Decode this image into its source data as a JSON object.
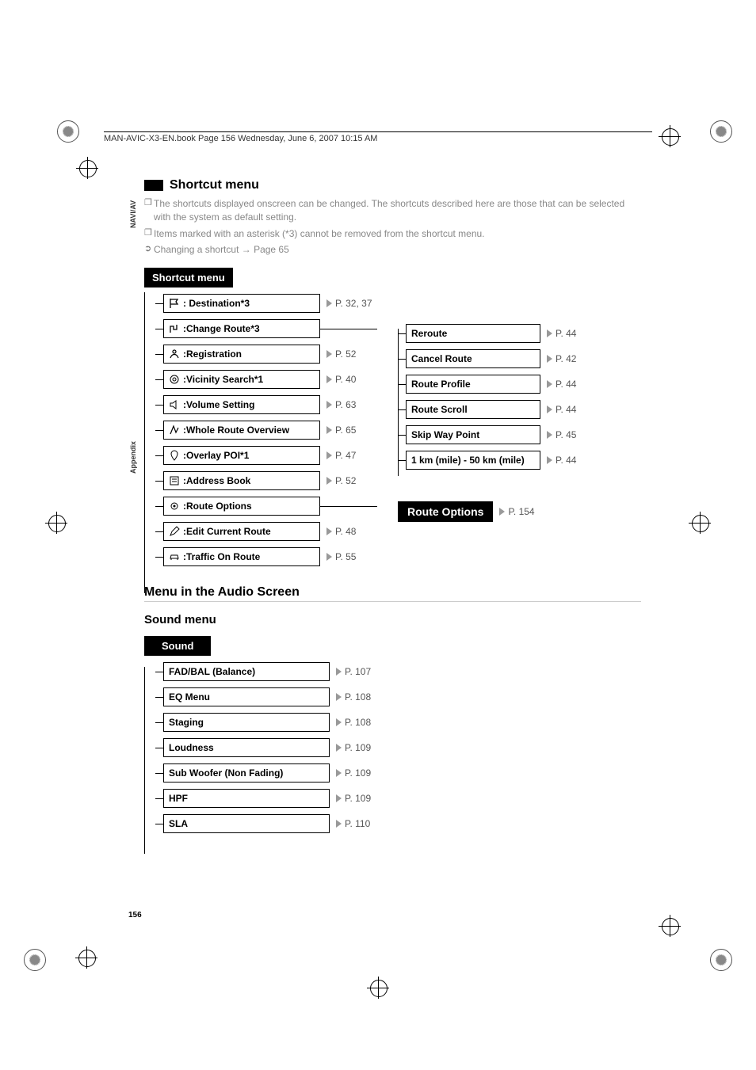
{
  "header_line": "MAN-AVIC-X3-EN.book  Page 156  Wednesday, June 6, 2007  10:15 AM",
  "side_labels": {
    "navav": "NAVI/AV",
    "appendix": "Appendix"
  },
  "shortcut": {
    "title": "Shortcut menu",
    "notes": [
      "The shortcuts displayed onscreen can be changed. The shortcuts described here are those that can be selected with the system as default setting.",
      "Items marked with an asterisk (*3) cannot be removed from the shortcut menu."
    ],
    "change_ref": "Changing a shortcut → Page 65",
    "box_title": "Shortcut menu",
    "items": [
      {
        "icon": "flag",
        "label": ": Destination*3",
        "page": "P. 32, 37"
      },
      {
        "icon": "change",
        "label": ":Change Route*3"
      },
      {
        "icon": "register",
        "label": ":Registration",
        "page": "P. 52"
      },
      {
        "icon": "radar",
        "label": ":Vicinity Search*1",
        "page": "P. 40"
      },
      {
        "icon": "speaker",
        "label": ":Volume Setting",
        "page": "P. 63"
      },
      {
        "icon": "maplines",
        "label": ":Whole Route Overview",
        "page": "P. 65"
      },
      {
        "icon": "pin",
        "label": ":Overlay POI*1",
        "page": "P. 47"
      },
      {
        "icon": "book",
        "label": ":Address Book",
        "page": "P. 52"
      },
      {
        "icon": "gear",
        "label": ":Route Options"
      },
      {
        "icon": "pencil",
        "label": ":Edit Current Route",
        "page": "P. 48"
      },
      {
        "icon": "car",
        "label": ":Traffic On Route",
        "page": "P. 55"
      }
    ],
    "change_route_children": [
      {
        "label": "Reroute",
        "page": "P. 44"
      },
      {
        "label": "Cancel Route",
        "page": "P. 42"
      },
      {
        "label": "Route Profile",
        "page": "P. 44"
      },
      {
        "label": "Route Scroll",
        "page": "P. 44"
      },
      {
        "label": "Skip Way Point",
        "page": "P. 45"
      },
      {
        "label": "1 km (mile) - 50 km (mile)",
        "page": "P. 44"
      }
    ],
    "route_options_ref": {
      "label": "Route Options",
      "page": "P. 154"
    }
  },
  "audio": {
    "heading": "Menu in the Audio Screen",
    "subheading": "Sound menu",
    "box_title": "Sound",
    "items": [
      {
        "label": "FAD/BAL (Balance)",
        "page": "P. 107"
      },
      {
        "label": "EQ Menu",
        "page": "P. 108"
      },
      {
        "label": "Staging",
        "page": "P. 108"
      },
      {
        "label": "Loudness",
        "page": "P. 109"
      },
      {
        "label": "Sub Woofer (Non Fading)",
        "page": "P. 109"
      },
      {
        "label": "HPF",
        "page": "P. 109"
      },
      {
        "label": "SLA",
        "page": "P. 110"
      }
    ]
  },
  "page_number": "156"
}
